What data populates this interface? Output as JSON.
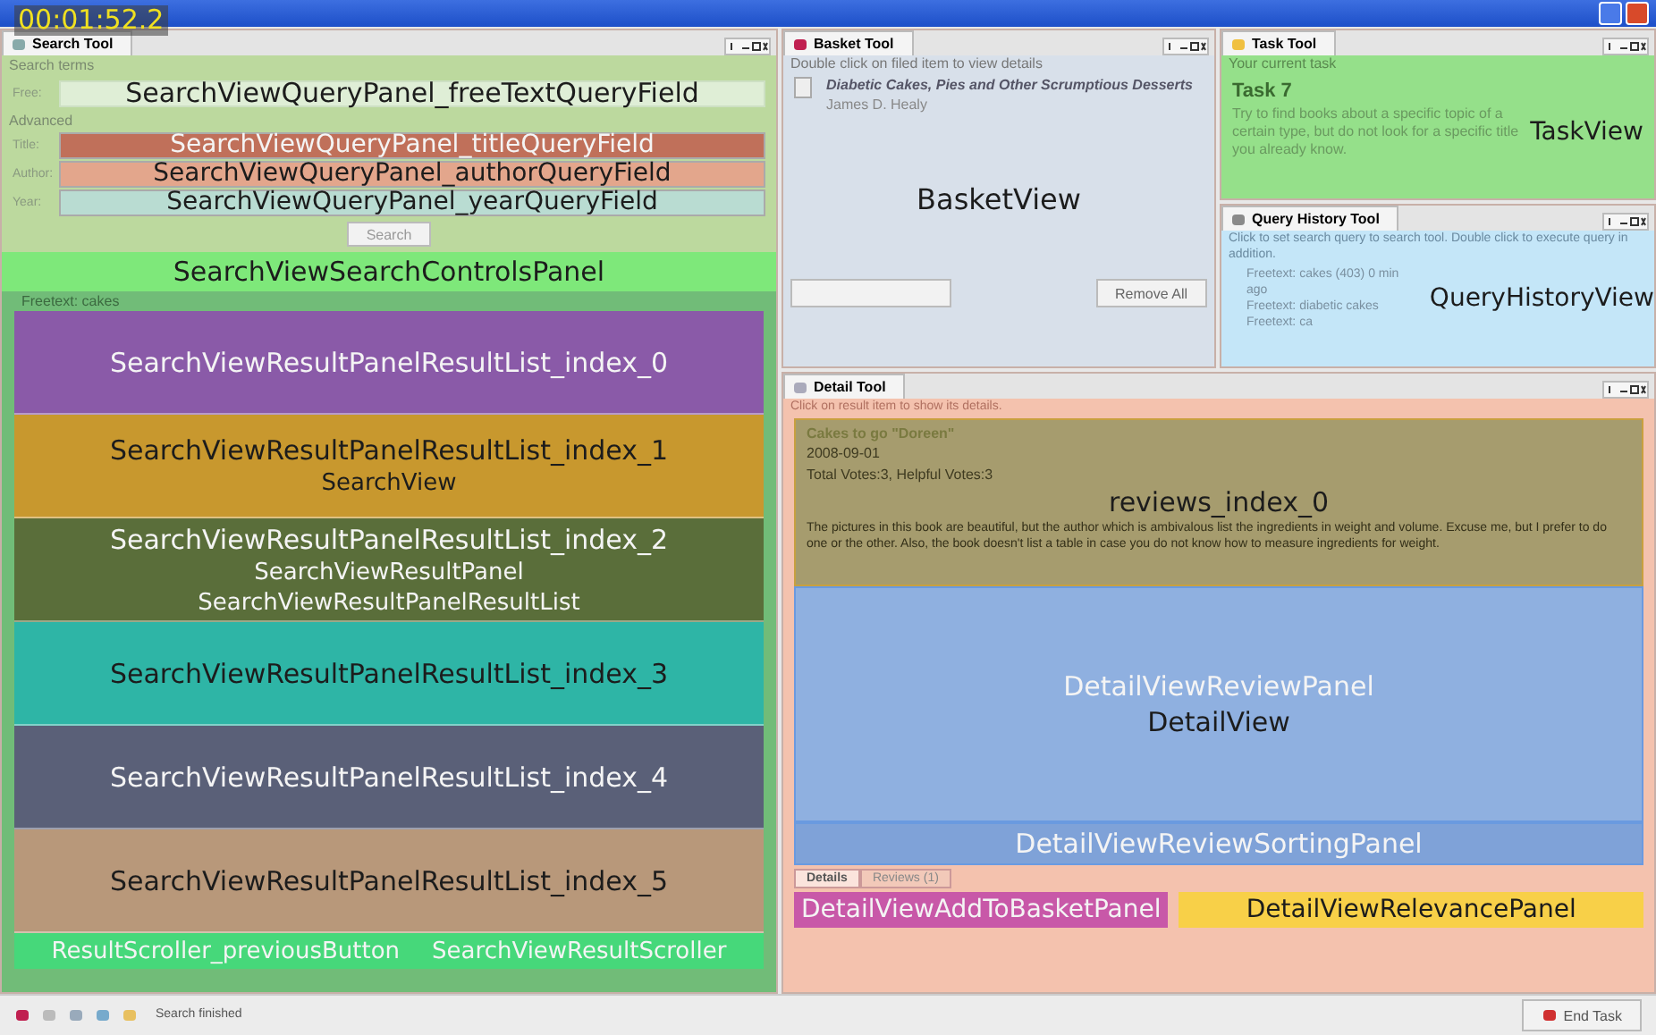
{
  "timer": "00:01:52.2",
  "search_tool": {
    "tab": "Search Tool",
    "section": "Search terms",
    "free_label": "Free:",
    "free_field": "SearchViewQueryPanel_freeTextQueryField",
    "advanced": "Advanced",
    "fields": [
      {
        "label": "Title:",
        "annotation": "SearchViewQueryPanel_titleQueryField",
        "color": "#c0705a",
        "light_text": true
      },
      {
        "label": "Author:",
        "annotation": "SearchViewQueryPanel_authorQueryField",
        "color": "#e3a68c",
        "light_text": false
      },
      {
        "label": "Year:",
        "annotation": "SearchViewQueryPanel_yearQueryField",
        "color": "#b9dcd2",
        "light_text": false
      }
    ],
    "search_button": "Search",
    "controls_panel": "SearchViewSearchControlsPanel",
    "result_header": "Freetext: cakes",
    "results": [
      {
        "annotation": "SearchViewResultPanelResultList_index_0",
        "color": "#8a5aa8",
        "light_text": true
      },
      {
        "annotation": "SearchViewResultPanelResultList_index_1",
        "color": "#c8982e",
        "light_text": false,
        "extra": [
          "SearchView"
        ]
      },
      {
        "annotation": "SearchViewResultPanelResultList_index_2",
        "color": "#5a6e3a",
        "light_text": true,
        "extra": [
          "SearchViewResultPanel",
          "SearchViewResultPanelResultList"
        ]
      },
      {
        "annotation": "SearchViewResultPanelResultList_index_3",
        "color": "#2eb5a6",
        "light_text": false
      },
      {
        "annotation": "SearchViewResultPanelResultList_index_4",
        "color": "#5a6078",
        "light_text": true
      },
      {
        "annotation": "SearchViewResultPanelResultList_index_5",
        "color": "#b8987a",
        "light_text": false
      }
    ],
    "scroller_labels": [
      "ResultScroller_previousButton",
      "SearchViewResultScroller"
    ]
  },
  "basket_tool": {
    "tab": "Basket Tool",
    "hint": "Double click on filed item to view details",
    "item_title": "Diabetic Cakes, Pies and Other Scrumptious Desserts",
    "item_author": "James D. Healy",
    "annotation": "BasketView",
    "remove_all": "Remove All"
  },
  "task_tool": {
    "tab": "Task Tool",
    "header": "Your current task",
    "title": "Task 7",
    "text": "Try to find books about a specific topic of a certain type, but do not look for a specific title you already know.",
    "annotation": "TaskView"
  },
  "query_history_tool": {
    "tab": "Query History Tool",
    "hint": "Click to set search query to search tool. Double click to execute query in addition.",
    "items": [
      "Freetext: cakes  (403) 0 min ago",
      "Freetext: diabetic cakes",
      "Freetext: ca"
    ],
    "annotation": "QueryHistoryView"
  },
  "detail_tool": {
    "tab": "Detail Tool",
    "hint": "Click on result item to show its details.",
    "review_title": "Cakes to go \"Doreen\"",
    "review_date": "2008-09-01",
    "review_votes": "Total Votes:3, Helpful Votes:3",
    "review_text": "The pictures in this book are beautiful, but the author which is ambivalous list the ingredients in weight and volume. Excuse me, but I prefer to do one or the other. Also, the book doesn't list a table in case you do not know how to measure ingredients for weight.",
    "review_annotation": "reviews_index_0",
    "panel_annotation": "DetailViewReviewPanel",
    "view_annotation": "DetailView",
    "sorting_annotation": "DetailViewReviewSortingPanel",
    "tabs": [
      {
        "label": "Details",
        "selected": true
      },
      {
        "label": "Reviews (1)",
        "selected": false
      }
    ],
    "basket_annotation": "DetailViewAddToBasketPanel",
    "relevance_annotation": "DetailViewRelevancePanel"
  },
  "status_bar": {
    "text": "Search finished",
    "end_button": "End Task"
  }
}
